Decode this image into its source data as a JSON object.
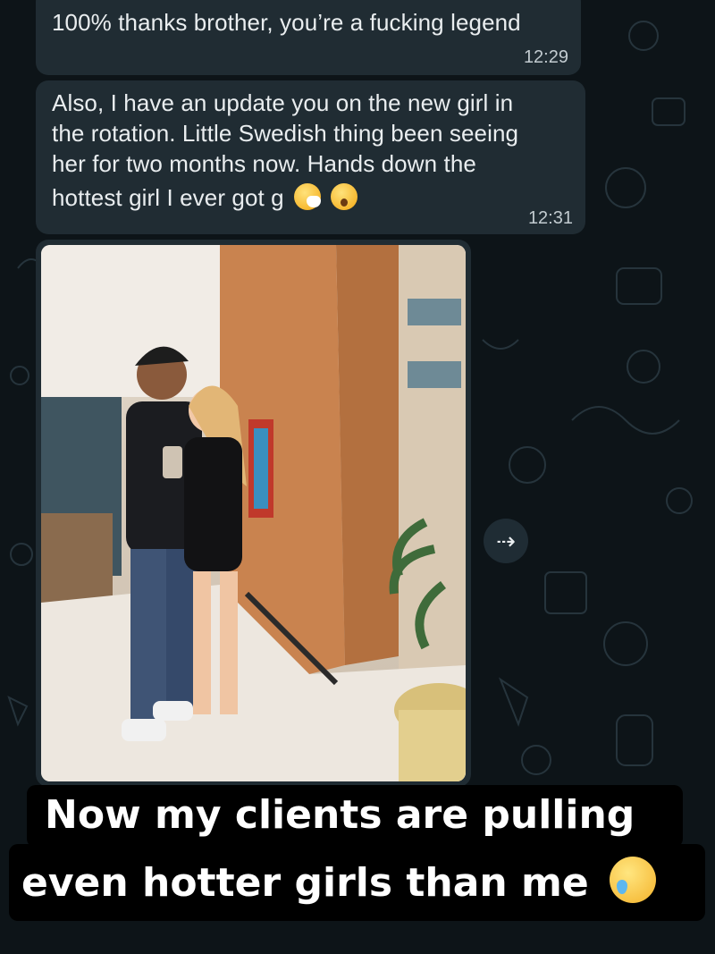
{
  "chat": {
    "messages": [
      {
        "text": "100% thanks brother, you’re a fucking legend",
        "time": "12:29"
      },
      {
        "lines": [
          "Also, I have an update you on the new girl in",
          "the rotation. Little Swedish thing been seeing",
          "her for two months now. Hands down the",
          "hottest girl I ever got g"
        ],
        "emojis": [
          "sneezing-face-emoji",
          "astonished-face-emoji"
        ],
        "time": "12:31"
      }
    ],
    "photo": {
      "icon": "forward-icon",
      "forward_glyph": "⇢"
    }
  },
  "caption": {
    "line1": "Now my clients are pulling",
    "line2": "even hotter girls than me",
    "emoji": "face-holding-back-tears-emoji"
  },
  "colors": {
    "background": "#0b141a",
    "bubble": "#202c33",
    "text": "#e9edef",
    "caption_bg": "#000000"
  }
}
